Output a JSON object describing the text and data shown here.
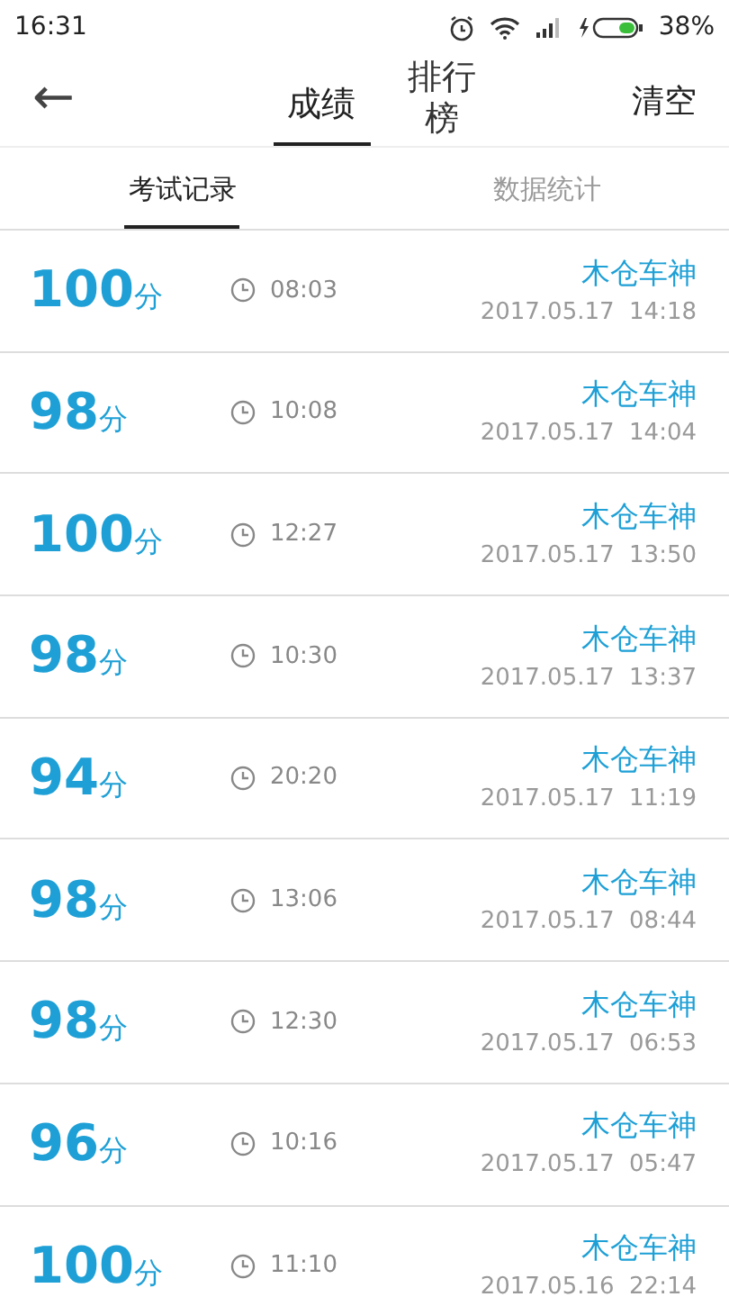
{
  "status_bar": {
    "time": "16:31",
    "battery": "38%"
  },
  "header": {
    "back": "←",
    "tabs": [
      {
        "label": "成绩",
        "selected": true
      },
      {
        "label": "排行榜",
        "selected": false
      }
    ],
    "action": "清空"
  },
  "sub_tabs": [
    {
      "label": "考试记录",
      "selected": true
    },
    {
      "label": "数据统计",
      "selected": false
    }
  ],
  "records": [
    {
      "score": "100",
      "unit": "分",
      "duration": "08:03",
      "user": "木仓车神",
      "date": "2017.05.17  14:18"
    },
    {
      "score": "98",
      "unit": "分",
      "duration": "10:08",
      "user": "木仓车神",
      "date": "2017.05.17  14:04"
    },
    {
      "score": "100",
      "unit": "分",
      "duration": "12:27",
      "user": "木仓车神",
      "date": "2017.05.17  13:50"
    },
    {
      "score": "98",
      "unit": "分",
      "duration": "10:30",
      "user": "木仓车神",
      "date": "2017.05.17  13:37"
    },
    {
      "score": "94",
      "unit": "分",
      "duration": "20:20",
      "user": "木仓车神",
      "date": "2017.05.17  11:19"
    },
    {
      "score": "98",
      "unit": "分",
      "duration": "13:06",
      "user": "木仓车神",
      "date": "2017.05.17  08:44"
    },
    {
      "score": "98",
      "unit": "分",
      "duration": "12:30",
      "user": "木仓车神",
      "date": "2017.05.17  06:53"
    },
    {
      "score": "96",
      "unit": "分",
      "duration": "10:16",
      "user": "木仓车神",
      "date": "2017.05.17  05:47"
    },
    {
      "score": "100",
      "unit": "分",
      "duration": "11:10",
      "user": "木仓车神",
      "date": "2017.05.16  22:14"
    }
  ]
}
